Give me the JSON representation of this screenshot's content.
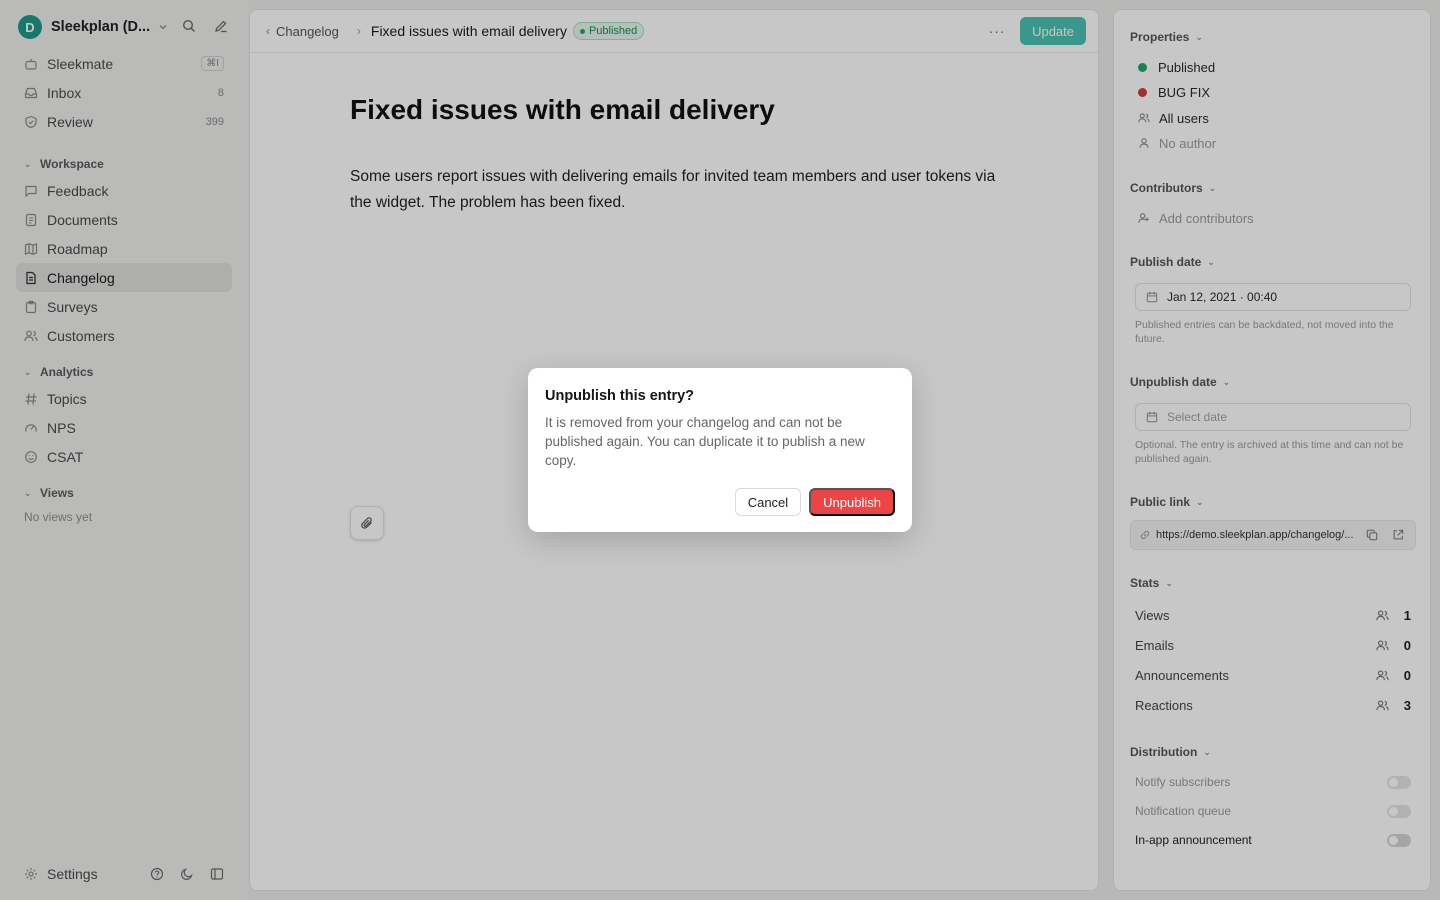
{
  "workspace": {
    "initial": "D",
    "name": "Sleekplan (D..."
  },
  "nav_top": [
    {
      "label": "Sleekmate",
      "icon": "bot-icon",
      "kbd": "⌘I"
    },
    {
      "label": "Inbox",
      "icon": "inbox-icon",
      "count": "8"
    },
    {
      "label": "Review",
      "icon": "shield-icon",
      "count": "399"
    }
  ],
  "sections": {
    "workspace": {
      "label": "Workspace",
      "items": [
        {
          "label": "Feedback",
          "icon": "message-icon"
        },
        {
          "label": "Documents",
          "icon": "documents-icon"
        },
        {
          "label": "Roadmap",
          "icon": "map-icon"
        },
        {
          "label": "Changelog",
          "icon": "changelog-icon",
          "active": true
        },
        {
          "label": "Surveys",
          "icon": "clipboard-icon"
        },
        {
          "label": "Customers",
          "icon": "users-icon"
        }
      ]
    },
    "analytics": {
      "label": "Analytics",
      "items": [
        {
          "label": "Topics",
          "icon": "hash-icon"
        },
        {
          "label": "NPS",
          "icon": "gauge-icon"
        },
        {
          "label": "CSAT",
          "icon": "smile-icon"
        }
      ]
    },
    "views": {
      "label": "Views",
      "empty": "No views yet"
    }
  },
  "footer": {
    "settings_label": "Settings"
  },
  "topbar": {
    "back_label": "Changelog",
    "title": "Fixed issues with email delivery",
    "status_badge": "Published",
    "update_label": "Update"
  },
  "document": {
    "title": "Fixed issues with email delivery",
    "body": "Some users report issues with delivering emails for invited team members and user tokens via the widget. The problem has been fixed."
  },
  "properties": {
    "label": "Properties",
    "status": "Published",
    "status_color": "#1ea86a",
    "tag": "BUG FIX",
    "tag_color": "#d13b3b",
    "audience": "All users",
    "author": "No author"
  },
  "contributors": {
    "label": "Contributors",
    "add_label": "Add contributors"
  },
  "publish_date": {
    "label": "Publish date",
    "value": "Jan 12, 2021 · 00:40",
    "hint": "Published entries can be backdated, not moved into the future."
  },
  "unpublish_date": {
    "label": "Unpublish date",
    "placeholder": "Select date",
    "hint": "Optional. The entry is archived at this time and can not be published again."
  },
  "public_link": {
    "label": "Public link",
    "url": "https://demo.sleekplan.app/changelog/..."
  },
  "stats": {
    "label": "Stats",
    "items": [
      {
        "label": "Views",
        "value": "1"
      },
      {
        "label": "Emails",
        "value": "0"
      },
      {
        "label": "Announcements",
        "value": "0"
      },
      {
        "label": "Reactions",
        "value": "3"
      }
    ]
  },
  "distribution": {
    "label": "Distribution",
    "items": [
      {
        "label": "Notify subscribers",
        "enabled": false
      },
      {
        "label": "Notification queue",
        "enabled": false
      },
      {
        "label": "In-app announcement",
        "enabled": true
      }
    ]
  },
  "modal": {
    "title": "Unpublish this entry?",
    "description": "It is removed from your changelog and can not be published again. You can duplicate it to publish a new copy.",
    "cancel_label": "Cancel",
    "confirm_label": "Unpublish"
  },
  "colors": {
    "accent": "#4bc3b1",
    "danger": "#ef4444",
    "workspace_avatar": "#1d9a8a"
  }
}
